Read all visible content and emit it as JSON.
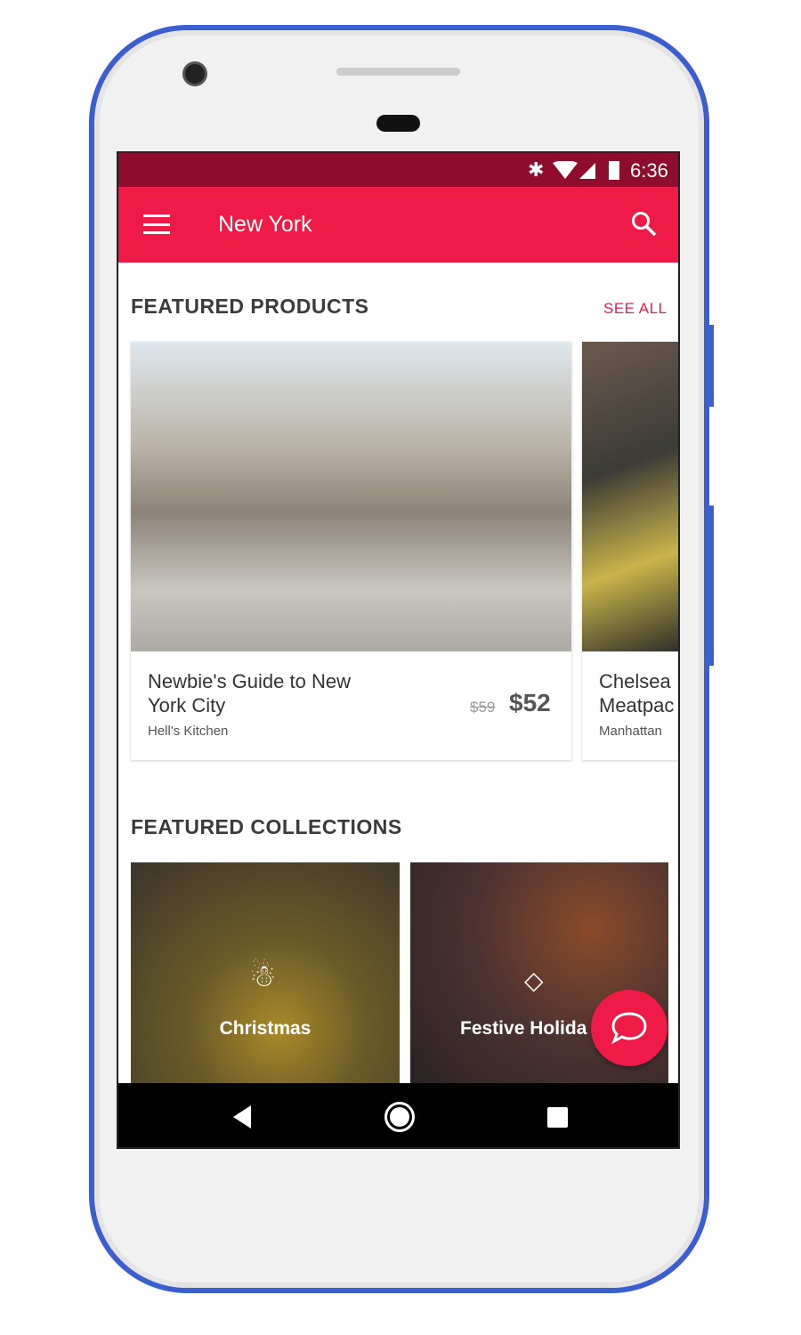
{
  "status_bar": {
    "time": "6:36",
    "icons": [
      "bluetooth-icon",
      "wifi-icon",
      "signal-icon",
      "battery-icon"
    ]
  },
  "app_bar": {
    "title": "New York",
    "menu_icon": "menu-icon",
    "search_icon": "search-icon"
  },
  "featured_products": {
    "title": "FEATURED PRODUCTS",
    "see_all": "SEE ALL",
    "items": [
      {
        "title_line1": "Newbie's Guide to New",
        "title_line2": "York City",
        "location": "Hell's Kitchen",
        "old_price": "$59",
        "price": "$52"
      },
      {
        "title_line1": "Chelsea",
        "title_line2": "Meatpac",
        "location": "Manhattan"
      }
    ]
  },
  "featured_collections": {
    "title": "FEATURED COLLECTIONS",
    "items": [
      {
        "label": "Christmas",
        "icon": "snowman-icon"
      },
      {
        "label": "Festive Holida",
        "icon": "diamond-icon"
      }
    ]
  },
  "fab": {
    "icon": "chat-icon"
  },
  "colors": {
    "accent": "#ef1a45",
    "status_bar": "#8e0d2c",
    "frame": "#3b5fd0"
  }
}
